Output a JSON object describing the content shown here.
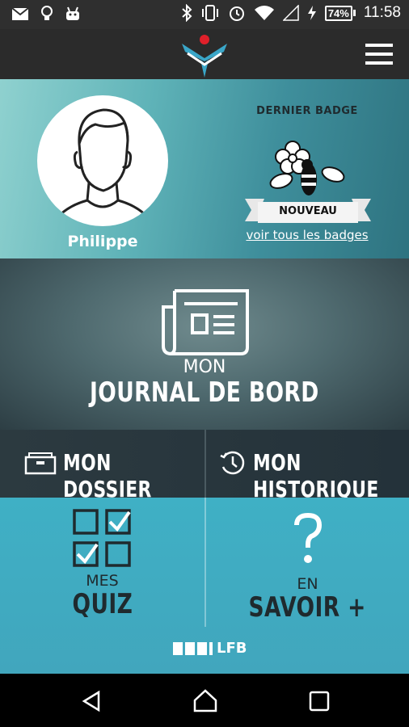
{
  "status_bar": {
    "battery_percent": "74%",
    "time": "11:58",
    "icons_left": [
      "mail-icon",
      "bulb-icon",
      "android-icon"
    ],
    "icons_right": [
      "bluetooth-icon",
      "vibrate-icon",
      "alarm-icon",
      "wifi-icon",
      "signal-icon",
      "charging-icon",
      "battery-icon"
    ]
  },
  "app_bar": {
    "logo": "app-logo",
    "menu_icon": "hamburger-menu-icon"
  },
  "profile": {
    "name": "Philippe",
    "badge_title": "DERNIER BADGE",
    "badge_ribbon": "NOUVEAU",
    "badge_link": "voir tous les badges"
  },
  "journal": {
    "line1": "MON",
    "line2": "JOURNAL DE BORD"
  },
  "dossier": {
    "label": "MON DOSSIER"
  },
  "historique": {
    "label": "MON HISTORIQUE"
  },
  "quiz": {
    "line1": "MES",
    "line2": "QUIZ"
  },
  "savoir": {
    "line1": "EN",
    "line2": "SAVOIR +"
  },
  "footer": {
    "logo_text": "LFB"
  },
  "colors": {
    "accent": "#3fb0c5",
    "dark": "#2b2b2b",
    "logo_red": "#e0202a",
    "logo_blue": "#3aa6c8"
  }
}
